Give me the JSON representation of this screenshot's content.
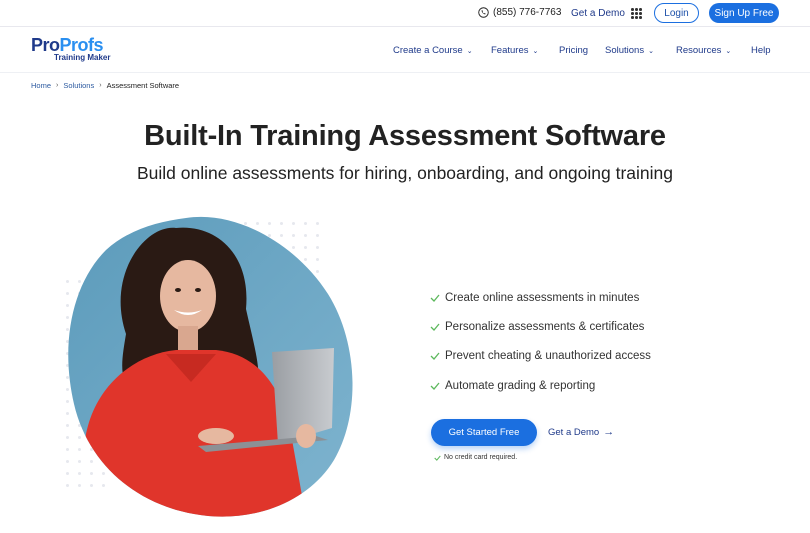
{
  "topbar": {
    "phone": "(855) 776-7763",
    "demo_label": "Get a Demo",
    "login_label": "Login",
    "signup_label": "Sign Up Free"
  },
  "logo": {
    "part1": "Pro",
    "part2": "Profs",
    "subtitle": "Training Maker"
  },
  "nav": {
    "items": [
      {
        "label": "Create a Course",
        "dropdown": true
      },
      {
        "label": "Features",
        "dropdown": true
      },
      {
        "label": "Pricing",
        "dropdown": false
      },
      {
        "label": "Solutions",
        "dropdown": true
      },
      {
        "label": "Resources",
        "dropdown": true
      },
      {
        "label": "Help",
        "dropdown": false
      }
    ]
  },
  "breadcrumb": {
    "items": [
      "Home",
      "Solutions"
    ],
    "current": "Assessment Software"
  },
  "hero": {
    "title": "Built-In Training Assessment Software",
    "subtitle": "Build online assessments for hiring, onboarding, and ongoing training",
    "image_alt": "Smiling woman in red hoodie holding a laptop"
  },
  "features": [
    "Create online assessments in minutes",
    "Personalize assessments & certificates",
    "Prevent cheating & unauthorized access",
    "Automate grading & reporting"
  ],
  "cta": {
    "primary_label": "Get Started Free",
    "secondary_label": "Get a Demo",
    "note": "No credit card required."
  },
  "colors": {
    "brand_dark": "#1f3a8a",
    "brand_blue": "#1b6fe0",
    "check_green": "#5cb85c",
    "blob_blue": "#6fa7c4",
    "hoodie_red": "#e0352b"
  }
}
